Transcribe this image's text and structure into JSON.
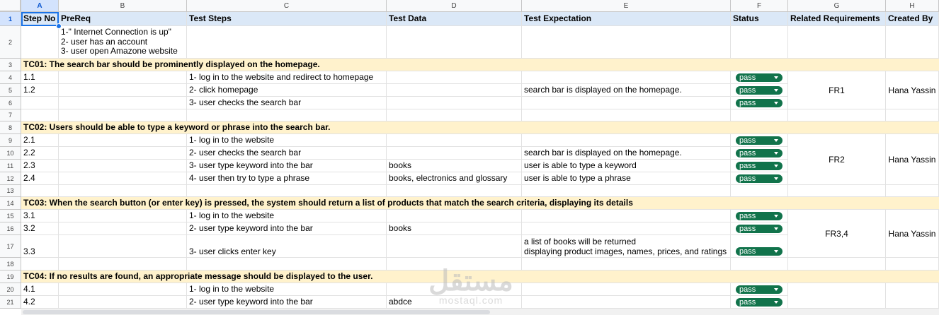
{
  "columns": [
    "A",
    "B",
    "C",
    "D",
    "E",
    "F",
    "G",
    "H"
  ],
  "rownums": [
    "1",
    "2",
    "3",
    "4",
    "5",
    "6",
    "7",
    "8",
    "9",
    "10",
    "11",
    "12",
    "13",
    "14",
    "15",
    "16",
    "17",
    "18",
    "19",
    "20",
    "21"
  ],
  "header": {
    "step_no": "Step No",
    "prereq": "PreReq",
    "test_steps": "Test Steps",
    "test_data": "Test Data",
    "test_expectation": "Test Expectation",
    "status": "Status",
    "related_requirements": "Related Requirements",
    "created_by": "Created By"
  },
  "prereq": {
    "line1": "1-\" Internet Connection is up\"",
    "line2": "2- user has an account",
    "line3": "3- user open Amazone website"
  },
  "tc01": {
    "title": "TC01: The search bar should be prominently displayed on the homepage.",
    "rows": [
      {
        "step": "1.1",
        "test_step": "1- log in to the website and redirect to homepage",
        "data": "",
        "expect": ""
      },
      {
        "step": "1.2",
        "test_step": "2- click homepage",
        "data": "",
        "expect": "search bar is displayed on the homepage."
      },
      {
        "step": "",
        "test_step": "3- user checks the search bar",
        "data": "",
        "expect": ""
      }
    ],
    "req": "FR1",
    "created_by": "Hana Yassin"
  },
  "tc02": {
    "title": "TC02: Users should be able to type a keyword or phrase into the search bar.",
    "rows": [
      {
        "step": "2.1",
        "test_step": "1- log in to the website",
        "data": "",
        "expect": ""
      },
      {
        "step": "2.2",
        "test_step": "2- user checks the search bar",
        "data": "",
        "expect": "search bar is displayed on the homepage."
      },
      {
        "step": "2.3",
        "test_step": "3- user type keyword into the bar",
        "data": "books",
        "expect": "user is able to type a keyword"
      },
      {
        "step": "2.4",
        "test_step": "4- user then try to type a phrase",
        "data": "books, electronics and glossary",
        "expect": "user is able to type a phrase"
      }
    ],
    "req": "FR2",
    "created_by": "Hana Yassin"
  },
  "tc03": {
    "title": "TC03: When the search button (or enter key) is pressed, the system should return a list of products that match the search criteria, displaying its details",
    "rows": [
      {
        "step": "3.1",
        "test_step": "1- log in to the website",
        "data": "",
        "expect": ""
      },
      {
        "step": "3.2",
        "test_step": "2- user type keyword into the bar",
        "data": "books",
        "expect": ""
      },
      {
        "step": "3.3",
        "test_step": "3- user clicks enter key",
        "data": "",
        "expect_line1": "a list of books will be returned",
        "expect_line2": "displaying product images, names, prices, and ratings"
      }
    ],
    "req": "FR3,4",
    "created_by": "Hana Yassin"
  },
  "tc04": {
    "title": "TC04: If no results are found, an appropriate message should be displayed to the user.",
    "rows": [
      {
        "step": "4.1",
        "test_step": "1- log in to the website",
        "data": "",
        "expect": ""
      },
      {
        "step": "4.2",
        "test_step": "2- user type keyword into the bar",
        "data": "abdce",
        "expect": ""
      }
    ]
  },
  "status_value": "pass",
  "colors": {
    "pass_chip": "#11734b",
    "header_fill": "#dbe8f7",
    "testcase_fill": "#fff2cc",
    "selection": "#1a73e8"
  },
  "watermark": {
    "arabic": "مستقل",
    "latin": "mostaql.com"
  }
}
